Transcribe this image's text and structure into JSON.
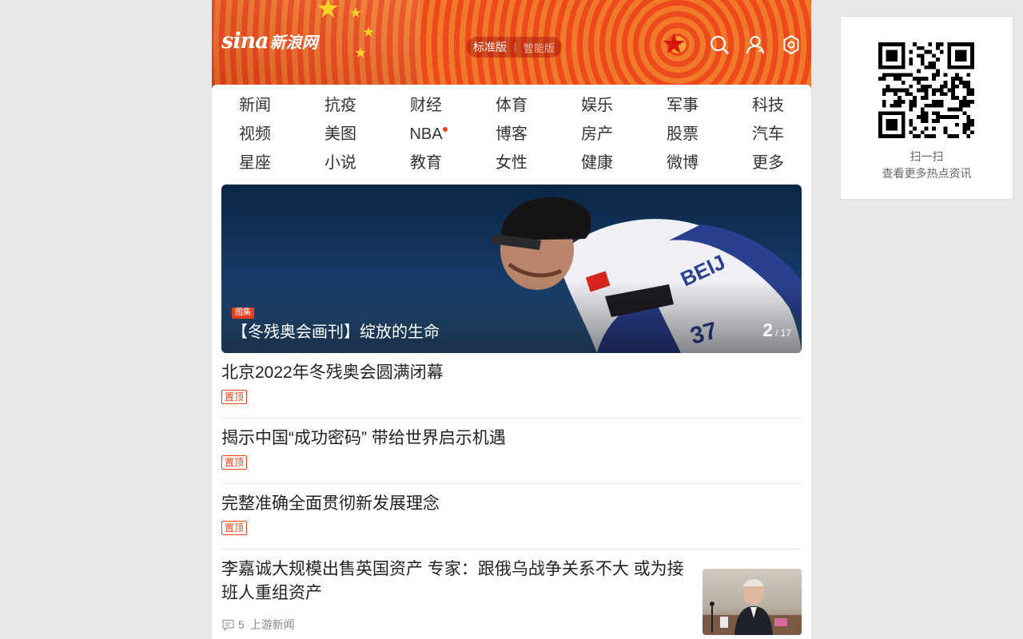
{
  "header": {
    "logo_latin": "sina",
    "logo_cn": "新浪网",
    "version_active": "标准版",
    "version_separator": "|",
    "version_inactive": "智能版"
  },
  "nav": {
    "rows": [
      [
        "新闻",
        "抗疫",
        "财经",
        "体育",
        "娱乐",
        "军事",
        "科技"
      ],
      [
        "视频",
        "美图",
        "NBA",
        "博客",
        "房产",
        "股票",
        "汽车"
      ],
      [
        "星座",
        "小说",
        "教育",
        "女性",
        "健康",
        "微博",
        "更多"
      ]
    ]
  },
  "feature": {
    "tag": "图集",
    "title": "【冬残奥会画刊】绽放的生命",
    "current": "2",
    "total": "/ 17"
  },
  "news": [
    {
      "title": "北京2022年冬残奥会圆满闭幕",
      "tag": "置顶"
    },
    {
      "title": "揭示中国“成功密码” 带给世界启示机遇",
      "tag": "置顶"
    },
    {
      "title": "完整准确全面贯彻新发展理念",
      "tag": "置顶"
    },
    {
      "title": "李嘉诚大规模出售英国资产 专家：跟俄乌战争关系不大 或为接班人重组资产",
      "comments": "5",
      "source": "上游新闻"
    }
  ],
  "qr": {
    "line1": "扫一扫",
    "line2": "查看更多热点资讯"
  },
  "colors": {
    "accent": "#e8401c",
    "page_bg": "#e8e8e8",
    "header_red": "#e2230f"
  }
}
